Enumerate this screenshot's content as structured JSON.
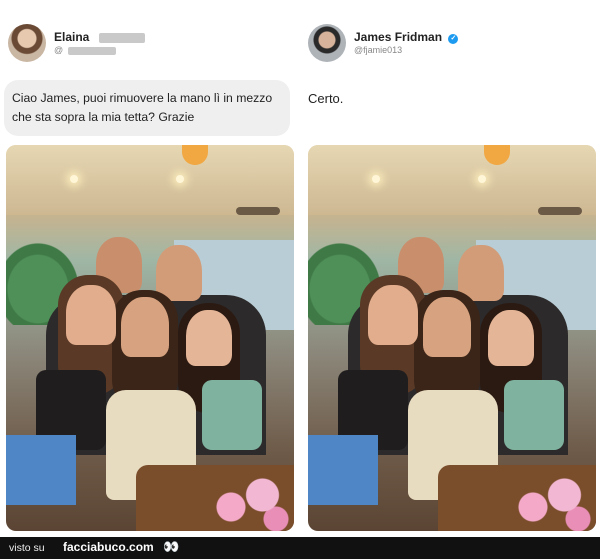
{
  "left_tweet": {
    "name": "Elaina",
    "handle": "@",
    "message": "Ciao James, puoi rimuovere la mano lì in mezzo che sta sopra la mia tetta? Grazie"
  },
  "right_tweet": {
    "name": "James Fridman",
    "handle": "@fjamie013",
    "reply": "Certo."
  },
  "footer": {
    "visto": "visto su",
    "site": "facciabuco.com",
    "eyes": "👀"
  },
  "colors": {
    "verified": "#1d9bf0",
    "footer_bg": "#111111",
    "bubble_bg": "#efefef"
  }
}
